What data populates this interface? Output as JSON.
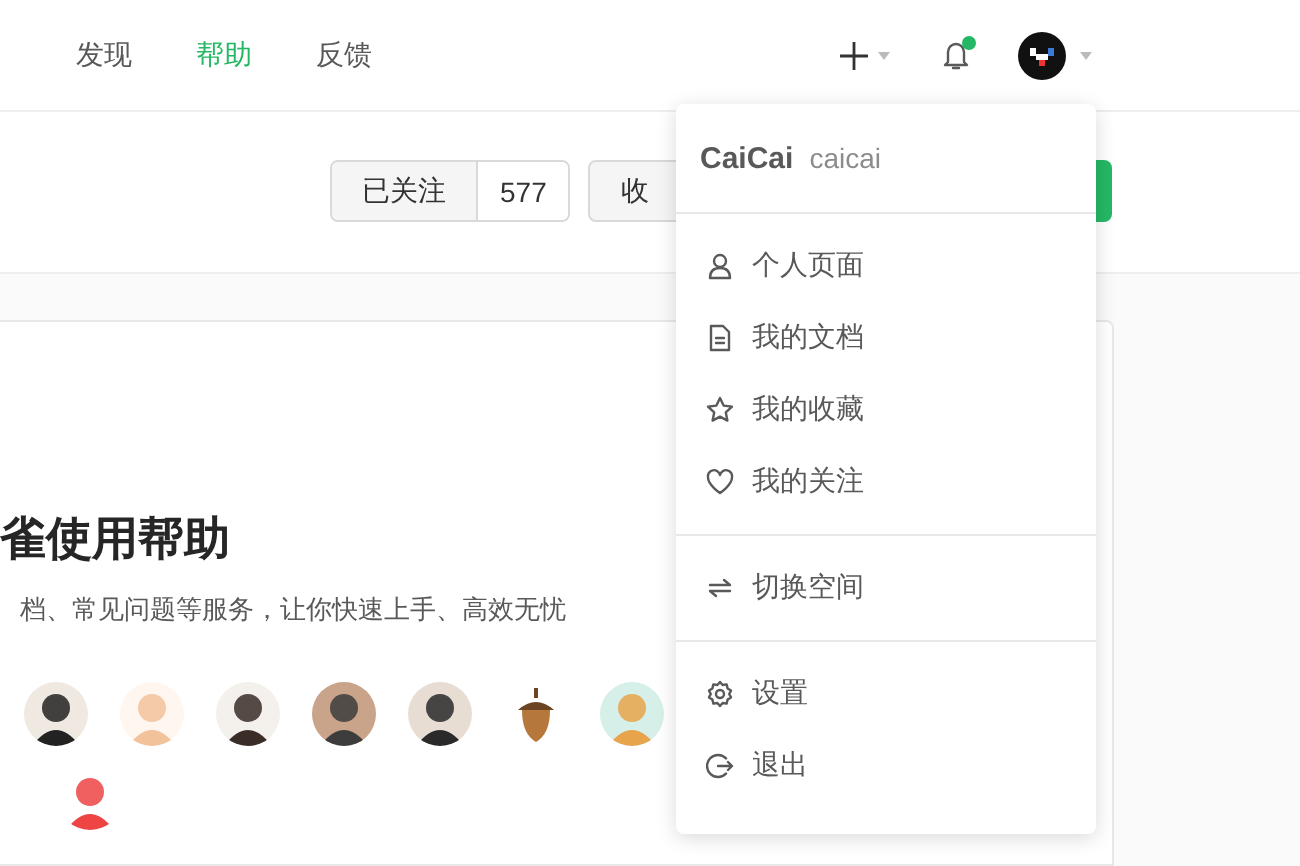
{
  "nav": {
    "items": [
      {
        "label": "发现",
        "selected": false
      },
      {
        "label": "帮助",
        "selected": true
      },
      {
        "label": "反馈",
        "selected": false
      }
    ],
    "notifications": {
      "unread": true
    }
  },
  "toolbar": {
    "follow_button": {
      "label": "已关注",
      "count": "577"
    },
    "collect_button": {
      "label": "收"
    }
  },
  "card": {
    "title": "雀使用帮助",
    "description": "档、常见问题等服务，让你快速上手、高效无忧"
  },
  "user_menu": {
    "name": "CaiCai",
    "handle": "caicai",
    "groups": [
      [
        {
          "kind": "person",
          "label": "个人页面"
        },
        {
          "kind": "document",
          "label": "我的文档"
        },
        {
          "kind": "star",
          "label": "我的收藏"
        },
        {
          "kind": "heart",
          "label": "我的关注"
        }
      ],
      [
        {
          "kind": "switch",
          "label": "切换空间"
        }
      ],
      [
        {
          "kind": "gear",
          "label": "设置"
        },
        {
          "kind": "logout",
          "label": "退出"
        }
      ]
    ]
  }
}
